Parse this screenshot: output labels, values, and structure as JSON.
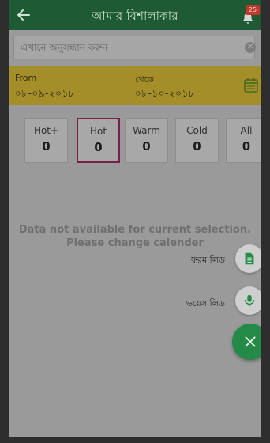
{
  "header": {
    "title": "আমার বিশালাকার",
    "notification_count": "25"
  },
  "search": {
    "placeholder": "এখানে অনুসন্ধান করুন"
  },
  "date_range": {
    "from_label": "From",
    "from_value": "০৮-০৯-২০১৮",
    "to_label": "থেকে",
    "to_value": "০৮-১০-২০১৮"
  },
  "tabs": [
    {
      "label": "Hot+",
      "count": "0"
    },
    {
      "label": "Hot",
      "count": "0"
    },
    {
      "label": "Warm",
      "count": "0"
    },
    {
      "label": "Cold",
      "count": "0"
    },
    {
      "label": "All",
      "count": "0"
    }
  ],
  "active_tab": "Hot",
  "empty_state": {
    "line1": "Data not available for current selection.",
    "line2": "Please change calender"
  },
  "fab_menu": {
    "form_lead_label": "ফরম লিড",
    "voice_lead_label": "ভয়েস লিড"
  },
  "colors": {
    "appbar": "#1e5a33",
    "date_bar": "#a48e2a",
    "active_tab_border": "#7a1f46",
    "fab": "#238a48"
  }
}
